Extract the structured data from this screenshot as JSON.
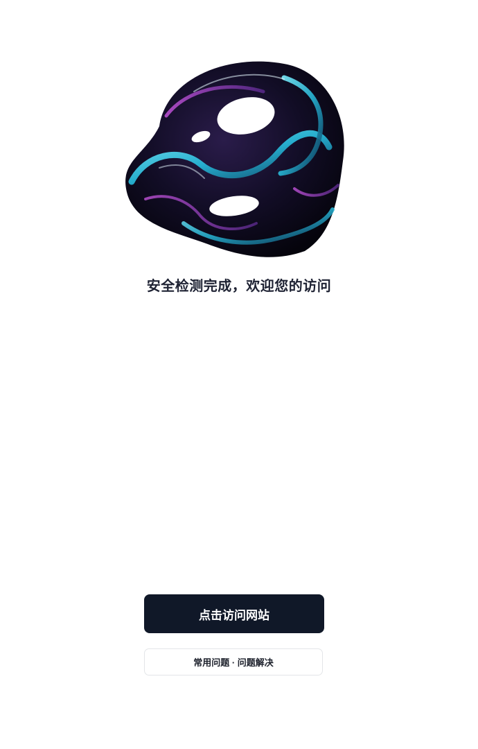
{
  "hero": {
    "image": "abstract-3d-iridescent-knot"
  },
  "headline": "安全检测完成，欢迎您的访问",
  "buttons": {
    "primary_label": "点击访问网站",
    "secondary_label": "常用问题 · 问题解决"
  },
  "colors": {
    "primary_button_bg": "#101828",
    "headline_text": "#1e2233",
    "secondary_button_border": "#e3e5e8"
  }
}
